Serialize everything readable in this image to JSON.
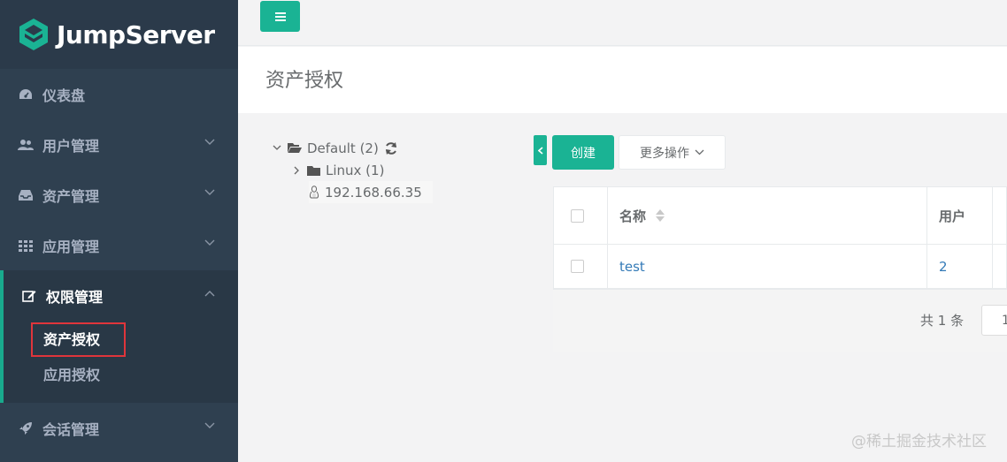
{
  "brand": {
    "name": "JumpServer"
  },
  "sidebar": {
    "items": [
      {
        "label": "仪表盘",
        "icon": "dashboard-icon"
      },
      {
        "label": "用户管理",
        "icon": "users-icon"
      },
      {
        "label": "资产管理",
        "icon": "inbox-icon"
      },
      {
        "label": "应用管理",
        "icon": "grid-icon"
      }
    ],
    "active_group": {
      "label": "权限管理",
      "icon": "edit-icon",
      "children": [
        {
          "label": "资产授权"
        },
        {
          "label": "应用授权"
        }
      ]
    },
    "bottom_item": {
      "label": "会话管理",
      "icon": "rocket-icon"
    }
  },
  "page": {
    "title": "资产授权"
  },
  "tree": {
    "root": {
      "label": "Default (2)"
    },
    "folder": {
      "label": "Linux (1)"
    },
    "leaf": {
      "label": "192.168.66.35"
    }
  },
  "toolbar": {
    "create_label": "创建",
    "more_label": "更多操作"
  },
  "table": {
    "columns": [
      "名称",
      "用户"
    ],
    "rows": [
      {
        "name": "test",
        "users": "2"
      }
    ]
  },
  "pager": {
    "total": "共 1 条",
    "page_value": "1"
  },
  "watermark": "@稀土掘金技术社区",
  "colors": {
    "accent": "#1ab394",
    "sidebar": "#2f4050",
    "link": "#337ab7",
    "highlight": "#e0353b"
  }
}
